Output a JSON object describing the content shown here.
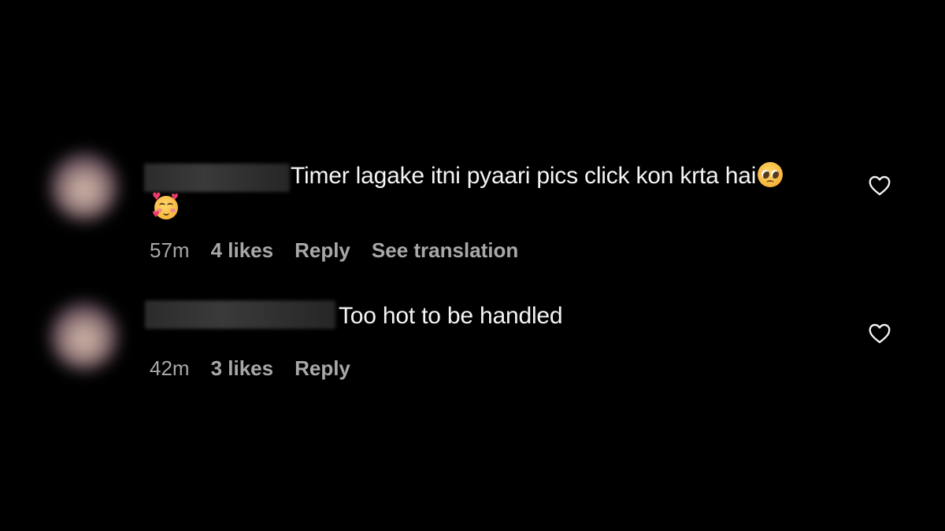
{
  "comments": [
    {
      "text": "Timer lagake itni pyaari pics click kon krta hai",
      "emojis": [
        "pleading-face-emoji",
        "smiling-face-with-hearts-emoji"
      ],
      "time": "57m",
      "likes": "4 likes",
      "reply": "Reply",
      "translation": "See translation"
    },
    {
      "text": "Too hot to be handled",
      "emojis": [],
      "time": "42m",
      "likes": "3 likes",
      "reply": "Reply"
    }
  ],
  "colors": {
    "background": "#000000",
    "text_primary": "#f5f5f5",
    "text_secondary": "#a8a8a8"
  },
  "icons": {
    "like": "heart-outline-icon"
  }
}
